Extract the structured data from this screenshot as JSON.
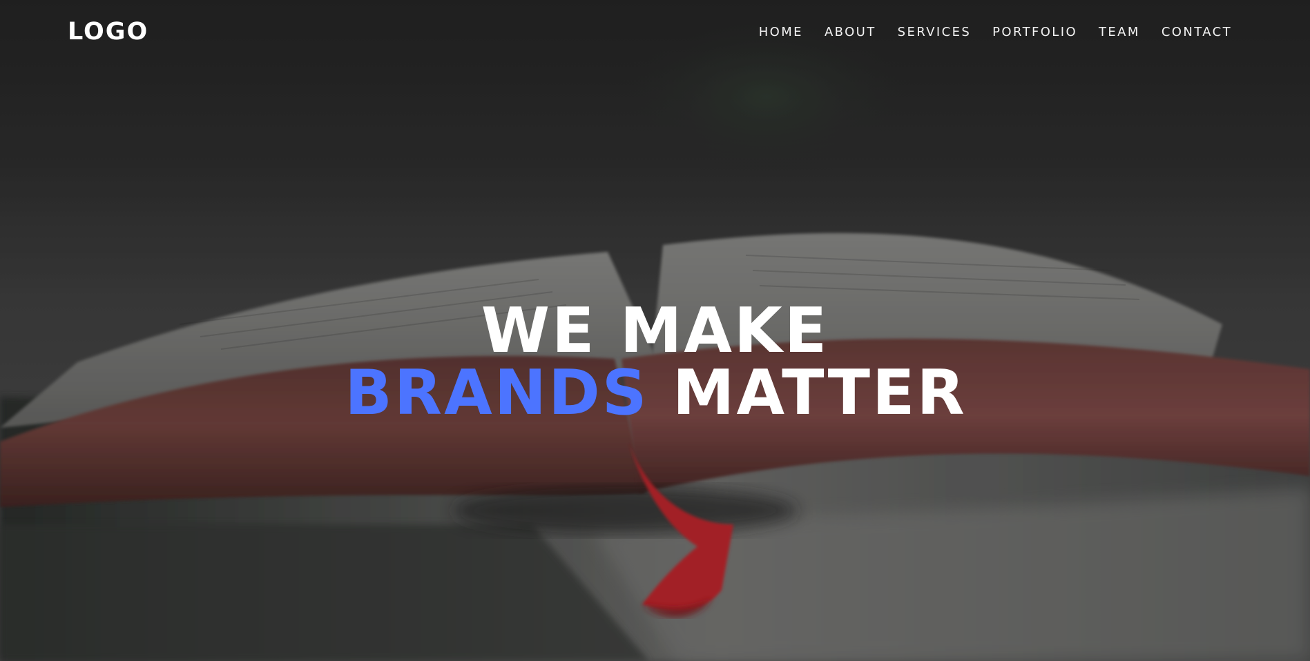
{
  "brand": {
    "logo": "LOGO"
  },
  "nav": {
    "items": [
      {
        "label": "HOME"
      },
      {
        "label": "ABOUT"
      },
      {
        "label": "SERVICES"
      },
      {
        "label": "PORTFOLIO"
      },
      {
        "label": "TEAM"
      },
      {
        "label": "CONTACT"
      }
    ]
  },
  "hero": {
    "line1": "WE MAKE",
    "line2_accent": "BRANDS",
    "line2_rest": " MATTER",
    "accent_color": "#4c74ff",
    "background_subject": "open-book"
  }
}
